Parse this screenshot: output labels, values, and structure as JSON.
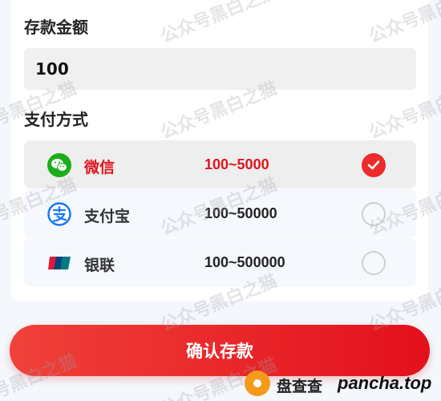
{
  "deposit": {
    "amount_title": "存款金额",
    "amount_value": "100",
    "method_title": "支付方式",
    "methods": [
      {
        "name": "微信",
        "range": "100~5000",
        "icon": "wechat-icon",
        "selected": true
      },
      {
        "name": "支付宝",
        "range": "100~50000",
        "icon": "alipay-icon",
        "selected": false
      },
      {
        "name": "银联",
        "range": "100~500000",
        "icon": "unionpay-icon",
        "selected": false
      }
    ],
    "confirm_label": "确认存款"
  },
  "colors": {
    "accent": "#e0141e",
    "selected_check": "#ee2b2b",
    "wechat": "#1aad19",
    "alipay": "#1677ff",
    "unionpay_red": "#e21836",
    "unionpay_blue": "#00447c",
    "unionpay_green": "#007b84"
  },
  "watermark": {
    "text": "公众号黑白之猫"
  },
  "brand": {
    "cn": "盘查查",
    "domain": "pancha.top"
  }
}
